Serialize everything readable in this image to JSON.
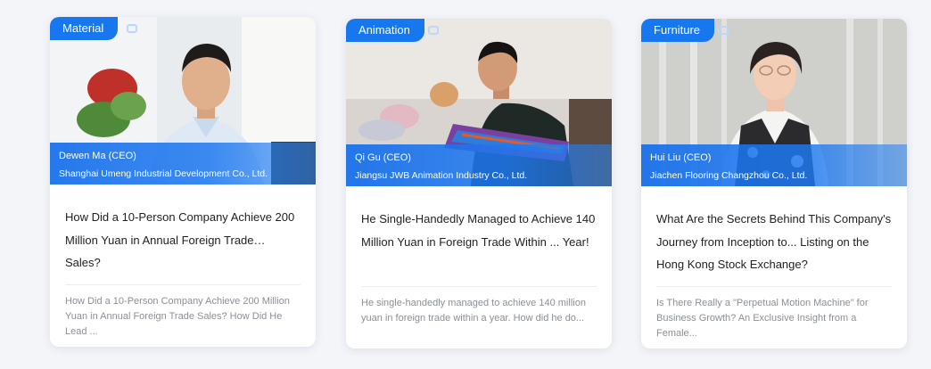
{
  "cards": [
    {
      "tag": "Material",
      "person": "Dewen Ma (CEO)",
      "company": "Shanghai Umeng Industrial Development Co., Ltd.",
      "title": "How Did a 10-Person Company Achieve 200 Million Yuan in Annual Foreign Trade… Sales?",
      "description": "How Did a 10-Person Company Achieve 200 Million Yuan in Annual Foreign Trade Sales? How Did He Lead ..."
    },
    {
      "tag": "Animation",
      "person": "Qi Gu (CEO)",
      "company": "Jiangsu JWB Animation Industry Co., Ltd.",
      "title": "He Single-Handedly Managed to Achieve 140 Million Yuan in Foreign Trade Within ... Year!",
      "description": "He single-handedly managed to achieve 140 million yuan in foreign trade within a year. How did he do..."
    },
    {
      "tag": "Furniture",
      "person": "Hui Liu (CEO)",
      "company": "Jiachen Flooring Changzhou Co., Ltd.",
      "title": "What Are the Secrets Behind This Company's Journey from Inception to... Listing on the Hong Kong Stock Exchange?",
      "description": "Is There Really a \"Perpetual Motion Machine\" for Business Growth? An Exclusive Insight from a Female..."
    }
  ],
  "colors": {
    "tag_background": "#1677ee",
    "page_background": "#f4f5f9",
    "title_text": "#222222",
    "description_text": "#8a8f99"
  }
}
